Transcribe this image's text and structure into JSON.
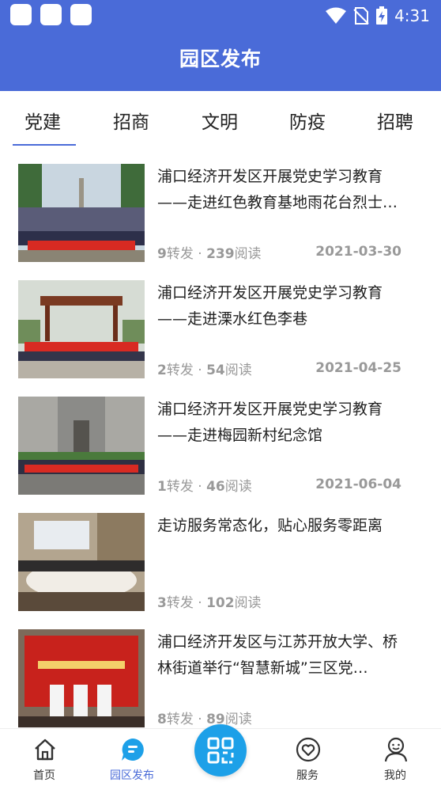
{
  "status_bar": {
    "time": "4:31"
  },
  "header": {
    "title": "园区发布"
  },
  "tabs": [
    {
      "label": "党建",
      "active": true
    },
    {
      "label": "招商",
      "active": false
    },
    {
      "label": "文明",
      "active": false
    },
    {
      "label": "防疫",
      "active": false
    },
    {
      "label": "招聘",
      "active": false
    }
  ],
  "articles": [
    {
      "title": "浦口经济开发区开展党史学习教育——走进红色教育基地雨花台烈士…",
      "shares": "9",
      "reads": "239",
      "date": "2021-03-30"
    },
    {
      "title": "浦口经济开发区开展党史学习教育——走进溧水红色李巷",
      "shares": "2",
      "reads": "54",
      "date": "2021-04-25"
    },
    {
      "title": "浦口经济开发区开展党史学习教育——走进梅园新村纪念馆",
      "shares": "1",
      "reads": "46",
      "date": "2021-06-04"
    },
    {
      "title": "走访服务常态化，贴心服务零距离",
      "shares": "3",
      "reads": "102",
      "date": ""
    },
    {
      "title": "浦口经济开发区与江苏开放大学、桥林街道举行“智慧新城”三区党…",
      "shares": "8",
      "reads": "89",
      "date": ""
    }
  ],
  "meta_labels": {
    "shares_suffix": "转发 · ",
    "reads_suffix": "阅读"
  },
  "bottom_nav": [
    {
      "label": "首页",
      "icon": "home-icon",
      "active": false
    },
    {
      "label": "园区发布",
      "icon": "chat-icon",
      "active": true
    },
    {
      "label": "",
      "icon": "scan-icon",
      "active": false
    },
    {
      "label": "服务",
      "icon": "heart-icon",
      "active": false
    },
    {
      "label": "我的",
      "icon": "person-icon",
      "active": false
    }
  ],
  "colors": {
    "primary": "#4a6bd8",
    "scan": "#1da0e8",
    "meta": "#999999"
  }
}
